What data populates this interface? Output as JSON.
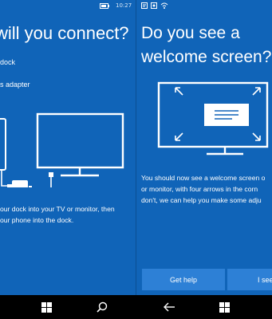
{
  "left_screen": {
    "status_time": "10:27",
    "title": "will you connect?",
    "options": [
      "dock",
      "s adapter"
    ],
    "caption_line1": "our dock into your TV or monitor, then",
    "caption_line2": "our phone into the dock."
  },
  "right_screen": {
    "title": "Do you see a welcome screen?",
    "caption_lines": [
      "You should now see a welcome screen o",
      "or monitor, with four arrows in the corn",
      "don't, we can help you make some adju"
    ],
    "buttons": {
      "get_help": "Get help",
      "see": "I see"
    }
  },
  "colors": {
    "background": "#1064b8",
    "button": "#2d80d6",
    "navbar": "#000000"
  },
  "navbar": {
    "icons": [
      "windows-icon",
      "search-icon",
      "back-icon",
      "windows-icon",
      "search-icon"
    ]
  }
}
